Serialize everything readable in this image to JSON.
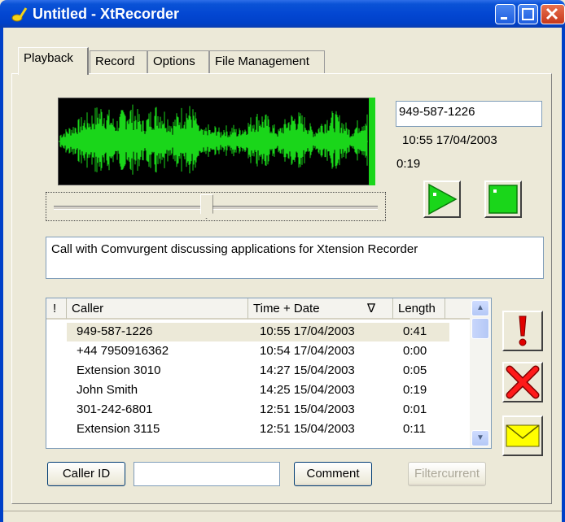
{
  "window": {
    "title": "Untitled - XtRecorder"
  },
  "tabs": [
    {
      "label": "Playback"
    },
    {
      "label": "Record"
    },
    {
      "label": "Options"
    },
    {
      "label": "File Management"
    }
  ],
  "playback": {
    "phone_number": "949-587-1226",
    "datetime": "10:55 17/04/2003",
    "duration": "0:19",
    "position_fraction": 0.47,
    "description": "Call with Comvurgent discussing applications for Xtension Recorder"
  },
  "list": {
    "columns": [
      "!",
      "Caller",
      "Time + Date",
      "Length"
    ],
    "sort_indicator": "∇",
    "rows": [
      {
        "caller": "949-587-1226",
        "time": "10:55 17/04/2003",
        "length": "0:41",
        "selected": true
      },
      {
        "caller": "+44 7950916362",
        "time": "10:54 17/04/2003",
        "length": "0:00"
      },
      {
        "caller": "Extension 3010",
        "time": "14:27 15/04/2003",
        "length": "0:05"
      },
      {
        "caller": "John Smith",
        "time": "14:25 15/04/2003",
        "length": "0:19"
      },
      {
        "caller": "301-242-6801",
        "time": "12:51 15/04/2003",
        "length": "0:01"
      },
      {
        "caller": "Extension 3115",
        "time": "12:51 15/04/2003",
        "length": "0:11"
      }
    ]
  },
  "buttons": {
    "caller_id": "Caller ID",
    "comment": "Comment",
    "filter": "Filtercurrent"
  },
  "filter_input": {
    "value": ""
  },
  "colors": {
    "wave": "#1ad61a",
    "titlebar": "#0347d2",
    "flag": "#e00000",
    "mail": "#ffff00"
  },
  "icons": [
    "app-icon",
    "minimize-icon",
    "maximize-icon",
    "close-icon",
    "play-icon",
    "stop-icon",
    "flag-icon",
    "delete-icon",
    "mail-icon"
  ]
}
